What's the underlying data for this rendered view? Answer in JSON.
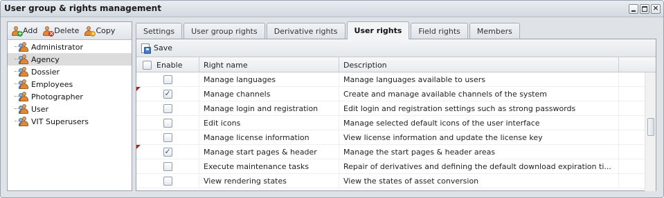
{
  "window": {
    "title": "User group & rights management"
  },
  "left_toolbar": {
    "add": "Add",
    "delete": "Delete",
    "copy": "Copy"
  },
  "groups": [
    "Administrator",
    "Agency",
    "Dossier",
    "Employees",
    "Photographer",
    "User",
    "VIT Superusers"
  ],
  "selected_group": "Agency",
  "tabs": [
    "Settings",
    "User group rights",
    "Derivative rights",
    "User rights",
    "Field rights",
    "Members"
  ],
  "active_tab": "User rights",
  "toolbar": {
    "save": "Save"
  },
  "grid": {
    "headers": {
      "enable": "Enable",
      "name": "Right name",
      "description": "Description"
    },
    "rows": [
      {
        "checked": false,
        "dirty": false,
        "name": "Manage languages",
        "description": "Manage languages available to users"
      },
      {
        "checked": true,
        "dirty": true,
        "name": "Manage channels",
        "description": "Create and manage available channels of the system"
      },
      {
        "checked": false,
        "dirty": false,
        "name": "Manage login and registration",
        "description": "Edit login and registration settings such as strong passwords"
      },
      {
        "checked": false,
        "dirty": false,
        "name": "Edit icons",
        "description": "Manage selected default icons of the user interface"
      },
      {
        "checked": false,
        "dirty": false,
        "name": "Manage license information",
        "description": "View license information and update the license key"
      },
      {
        "checked": true,
        "dirty": true,
        "name": "Manage start pages & header",
        "description": "Manage the start pages & header areas"
      },
      {
        "checked": false,
        "dirty": false,
        "name": "Execute maintenance tasks",
        "description": "Repair of derivatives and defining the default download expiration ti..."
      },
      {
        "checked": false,
        "dirty": false,
        "name": "View rendering states",
        "description": "View the states of asset conversion"
      }
    ]
  },
  "colors": {
    "dirty_marker": "#c0191b",
    "selection": "#dcdcdc",
    "chrome": "#dfe3e8"
  }
}
